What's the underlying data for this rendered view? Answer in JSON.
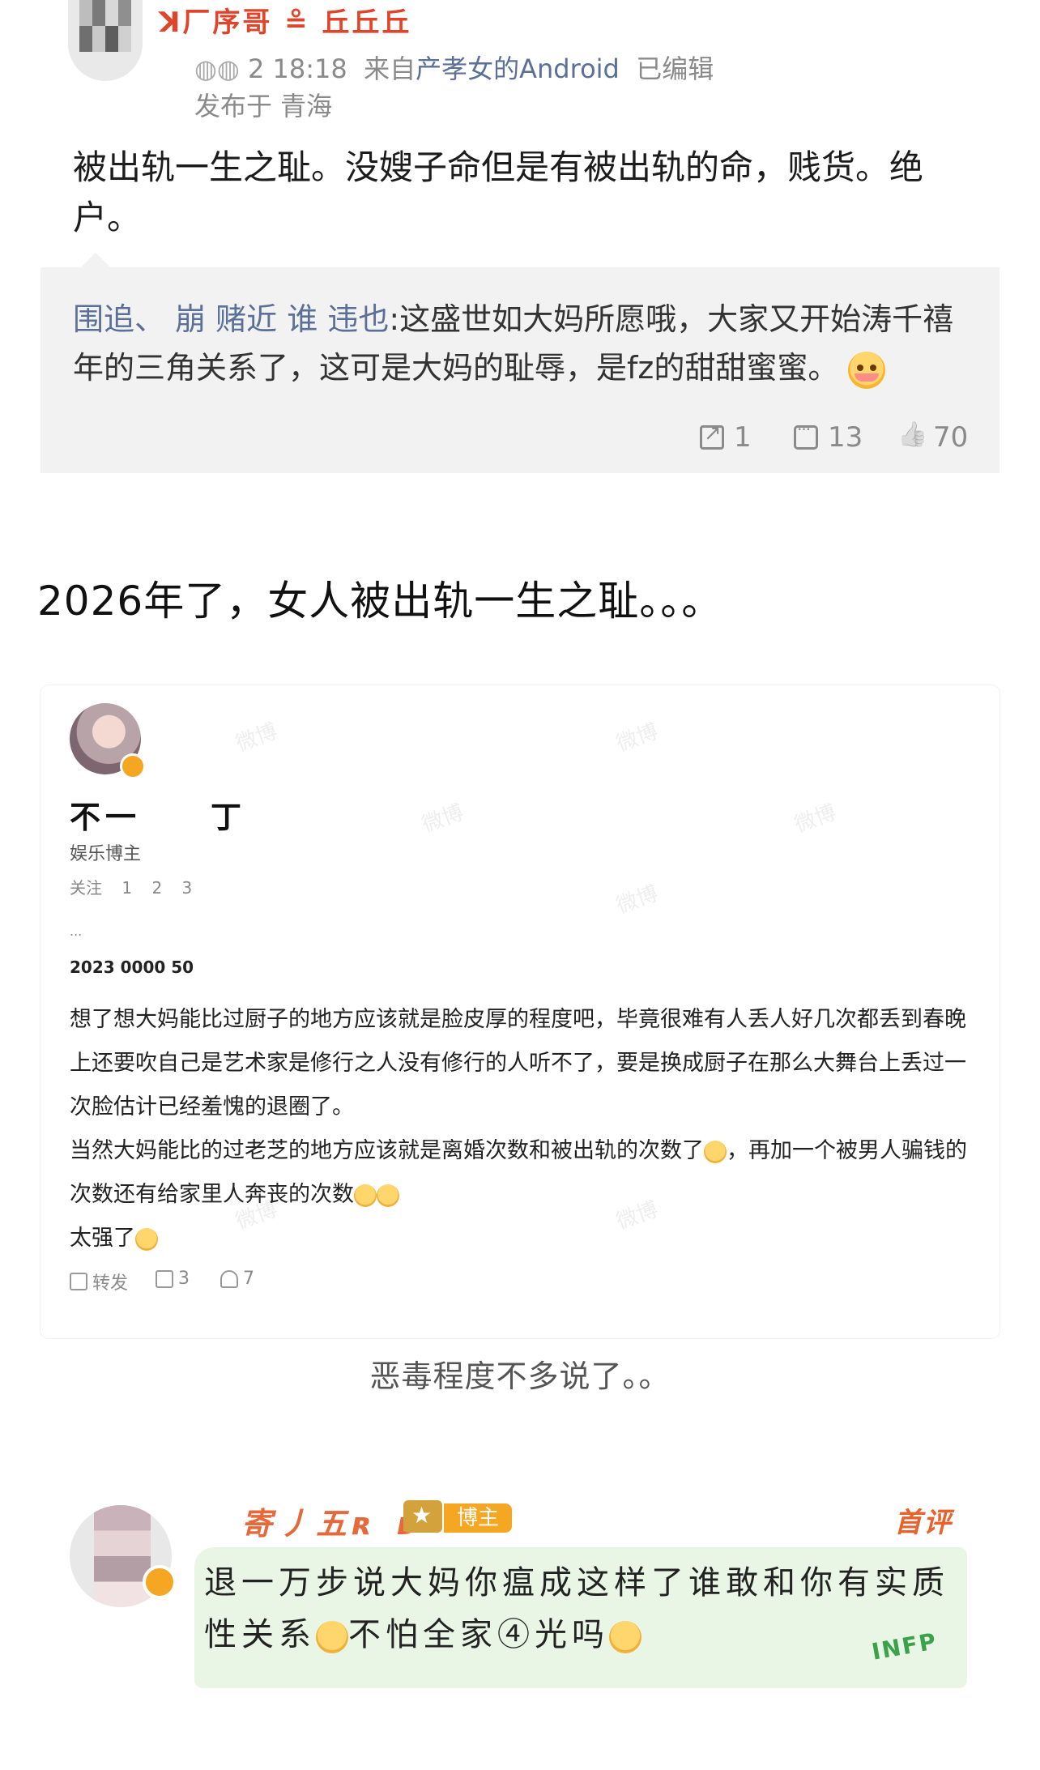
{
  "comment1": {
    "username": "ꓘ厂序哥 ≗ 丘丘丘",
    "meta_time": "2 18:18",
    "meta_from": "来自",
    "meta_source": "产孝女的Android",
    "meta_edited": "已编辑",
    "location": "发布于 青海",
    "body": "被出轨一生之耻。没嫂子命但是有被出轨的命，贱货。绝户。",
    "quote": {
      "name": "围追、 崩 赌近 谁 违也",
      "text": ":这盛世如大妈所愿哦，大家又开始涛千禧年的三角关系了，这可是大妈的耻辱，是fz的甜甜蜜蜜。"
    },
    "actions": {
      "share": "1",
      "comments": "13",
      "likes": "70"
    }
  },
  "caption1": "2026年了，女人被出轨一生之耻。。。",
  "comment2": {
    "name_left": "不一",
    "name_right": "丁",
    "tag": "娱乐博主",
    "stats": "关注 1 2 3",
    "dots": "...",
    "date": "2023 0000 50",
    "body_p1": "想了想大妈能比过厨子的地方应该就是脸皮厚的程度吧，毕竟很难有人丢人好几次都丢到春晚上还要吹自己是艺术家是修行之人没有修行的人听不了，要是换成厨子在那么大舞台上丢过一次脸估计已经羞愧的退圈了。",
    "body_p2a": "当然大妈能比的过老芝的地方应该就是离婚次数和被出轨的次数了",
    "body_p2b": "，再加一个被男人骗钱的次数还有给家里人奔丧的次数",
    "body_p3": "太强了",
    "actions": {
      "share": "转发",
      "comments": "3",
      "likes": "7"
    },
    "watermark": "微博"
  },
  "caption2": "恶毒程度不多说了。。",
  "comment3": {
    "name": "寄丿五ʀ ᴅ",
    "badge": "博主",
    "hot": "首评",
    "body_a": "退一万步说大妈你瘟成这样了谁敢和你有实质性关系",
    "body_b": "不怕全家④光吗",
    "infp": "INFP"
  },
  "colors": {
    "accent_red": "#e0452b",
    "link_blue": "#5b6f97",
    "gold": "#f5a623",
    "bubble_green": "#e9f6e6"
  }
}
